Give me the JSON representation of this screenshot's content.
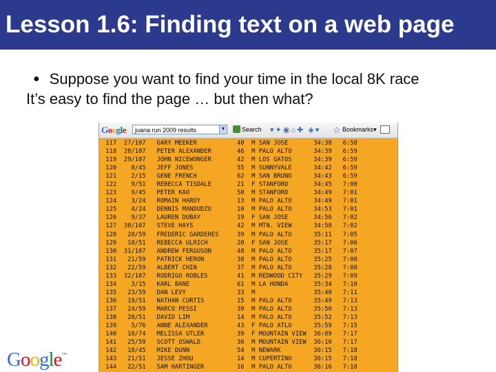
{
  "title": "Lesson 1.6:  Finding text on a web page",
  "bullet_symbol": "●",
  "bullet_text": "Suppose you want to find your time in the local 8K race",
  "second_line": "It’s easy to find the page … but then what?",
  "toolbar": {
    "google_label": "Google",
    "search_query": "juana run 2009 results",
    "search_label": "Search",
    "bookmarks_label": "Bookmarks▾"
  },
  "results": [
    {
      "place": "117",
      "div": "27/107",
      "name": "GARY MEEKER",
      "age": "40",
      "sex": "M",
      "city": "SAN JOSE",
      "time": "34:38",
      "pace": "6:58"
    },
    {
      "place": "118",
      "div": "28/107",
      "name": "PETER ALEXANDER",
      "age": "46",
      "sex": "M",
      "city": "PALO ALTO",
      "time": "34:39",
      "pace": "6:59"
    },
    {
      "place": "119",
      "div": "29/107",
      "name": "JOHN NICEWONGER",
      "age": "42",
      "sex": "M",
      "city": "LOS GATOS",
      "time": "34:39",
      "pace": "6:59"
    },
    {
      "place": "120",
      "div": "8/45",
      "name": "JEFF JONES",
      "age": "55",
      "sex": "M",
      "city": "SUNNYVALE",
      "time": "34:42",
      "pace": "6:59"
    },
    {
      "place": "121",
      "div": "2/15",
      "name": "GENE FRENCH",
      "age": "62",
      "sex": "M",
      "city": "SAN BRUNO",
      "time": "34:43",
      "pace": "6:59"
    },
    {
      "place": "122",
      "div": "9/51",
      "name": "REBECCA TISDALE",
      "age": "21",
      "sex": "F",
      "city": "STANFORD",
      "time": "34:45",
      "pace": "7:00"
    },
    {
      "place": "123",
      "div": "9/45",
      "name": "PETER KAO",
      "age": "50",
      "sex": "M",
      "city": "STANFORD",
      "time": "34:49",
      "pace": "7:01"
    },
    {
      "place": "124",
      "div": "3/24",
      "name": "ROMAIN HARDY",
      "age": "13",
      "sex": "M",
      "city": "PALO ALTO",
      "time": "34:49",
      "pace": "7:01"
    },
    {
      "place": "125",
      "div": "4/24",
      "name": "DENNIS MANDUDZO",
      "age": "10",
      "sex": "M",
      "city": "PALO ALTO",
      "time": "34:53",
      "pace": "7:01"
    },
    {
      "place": "126",
      "div": "9/37",
      "name": "LAUREN DUBAY",
      "age": "19",
      "sex": "F",
      "city": "SAN JOSE",
      "time": "34:56",
      "pace": "7:02"
    },
    {
      "place": "127",
      "div": "30/107",
      "name": "STEVE HAYS",
      "age": "42",
      "sex": "M",
      "city": "MTN. VIEW",
      "time": "34:58",
      "pace": "7:02"
    },
    {
      "place": "128",
      "div": "20/59",
      "name": "FREDERIC GARDERES",
      "age": "39",
      "sex": "M",
      "city": "PALO ALTO",
      "time": "35:11",
      "pace": "7:05"
    },
    {
      "place": "129",
      "div": "10/51",
      "name": "REBECCA ULRICH",
      "age": "20",
      "sex": "F",
      "city": "SAN JOSE",
      "time": "35:17",
      "pace": "7:06"
    },
    {
      "place": "130",
      "div": "31/107",
      "name": "ANDREW FERGUSON",
      "age": "48",
      "sex": "M",
      "city": "PALO ALTO",
      "time": "35:17",
      "pace": "7:07"
    },
    {
      "place": "131",
      "div": "21/59",
      "name": "PATRICK HERON",
      "age": "38",
      "sex": "M",
      "city": "PALO ALTO",
      "time": "35:25",
      "pace": "7:08"
    },
    {
      "place": "132",
      "div": "22/59",
      "name": "ALBERT CHIN",
      "age": "37",
      "sex": "M",
      "city": "PALO ALTO",
      "time": "35:28",
      "pace": "7:08"
    },
    {
      "place": "133",
      "div": "32/107",
      "name": "RODRIGO ROBLES",
      "age": "41",
      "sex": "M",
      "city": "REDWOOD CITY",
      "time": "35:29",
      "pace": "7:09"
    },
    {
      "place": "134",
      "div": "3/15",
      "name": "KARL BANE",
      "age": "61",
      "sex": "M",
      "city": "LA HONDA",
      "time": "35:34",
      "pace": "7:10"
    },
    {
      "place": "135",
      "div": "23/59",
      "name": "DAN LEVY",
      "age": "33",
      "sex": "M",
      "city": "",
      "time": "35:40",
      "pace": "7:11"
    },
    {
      "place": "136",
      "div": "19/51",
      "name": "NATHAN CURTIS",
      "age": "15",
      "sex": "M",
      "city": "PALO ALTO",
      "time": "35:49",
      "pace": "7:13"
    },
    {
      "place": "137",
      "div": "24/59",
      "name": "MARCO PESSI",
      "age": "39",
      "sex": "M",
      "city": "PALO ALTO",
      "time": "35:50",
      "pace": "7:13"
    },
    {
      "place": "138",
      "div": "20/51",
      "name": "DAVID LIM",
      "age": "14",
      "sex": "M",
      "city": "PALO ALTO",
      "time": "35:52",
      "pace": "7:13"
    },
    {
      "place": "139",
      "div": "5/76",
      "name": "ANNE ALEXANDER",
      "age": "43",
      "sex": "F",
      "city": "PALO ATLO",
      "time": "35:59",
      "pace": "7:15"
    },
    {
      "place": "140",
      "div": "10/74",
      "name": "MELISSA UTLER",
      "age": "39",
      "sex": "F",
      "city": "MOUNTAIN VIEW",
      "time": "36:09",
      "pace": "7:17"
    },
    {
      "place": "141",
      "div": "25/59",
      "name": "SCOTT OSWALD",
      "age": "30",
      "sex": "M",
      "city": "MOUNTAIN VIEW",
      "time": "36:10",
      "pace": "7:17"
    },
    {
      "place": "142",
      "div": "10/45",
      "name": "MIKE DUNN",
      "age": "54",
      "sex": "M",
      "city": "NEWARK",
      "time": "36:15",
      "pace": "7:18"
    },
    {
      "place": "143",
      "div": "21/51",
      "name": "JESSE ZHOU",
      "age": "14",
      "sex": "M",
      "city": "CUPERTINO",
      "time": "36:15",
      "pace": "7:18"
    },
    {
      "place": "144",
      "div": "22/51",
      "name": "SAM HARTINGER",
      "age": "16",
      "sex": "M",
      "city": "PALO ALTO",
      "time": "36:16",
      "pace": "7:18"
    }
  ],
  "logo_text": "Google",
  "logo_mark": "™",
  "colors": {
    "title_bar": "#2b3a8c",
    "results_background": "#f5a623",
    "logo_blue": "#3369e8",
    "logo_red": "#d50f25",
    "logo_yellow": "#eeb211",
    "logo_green": "#009925"
  }
}
